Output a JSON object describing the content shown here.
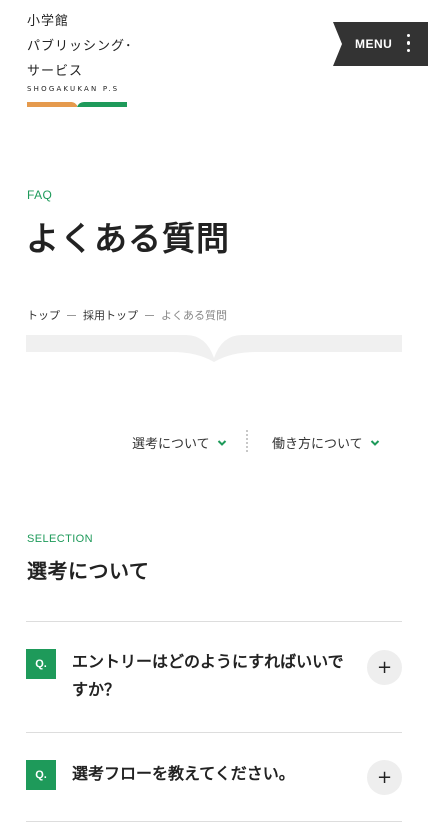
{
  "header": {
    "logo_lines": [
      "小学館",
      "パブリッシング･",
      "サービス"
    ],
    "logo_sub": "SHOGAKUKAN P.S",
    "logo_colors": {
      "orange": "#e59a4d",
      "green": "#1e9a5a"
    },
    "menu_label": "MENU"
  },
  "hero": {
    "eyebrow": "FAQ",
    "title": "よくある質問"
  },
  "breadcrumb": {
    "items": [
      "トップ",
      "採用トップ",
      "よくある質問"
    ]
  },
  "anchor_nav": {
    "items": [
      {
        "label": "選考について",
        "icon": "chevron-down-icon"
      },
      {
        "label": "働き方について",
        "icon": "chevron-down-icon"
      }
    ]
  },
  "section": {
    "eyebrow": "SELECTION",
    "title": "選考について"
  },
  "faq": {
    "badge": "Q.",
    "toggle_symbol": "+",
    "items": [
      {
        "question": "エントリーはどのようにすればいいですか？"
      },
      {
        "question": "選考フローを教えてください。"
      }
    ]
  },
  "colors": {
    "accent": "#1e9a5a",
    "menu_bg": "#333333",
    "text": "#222222"
  }
}
